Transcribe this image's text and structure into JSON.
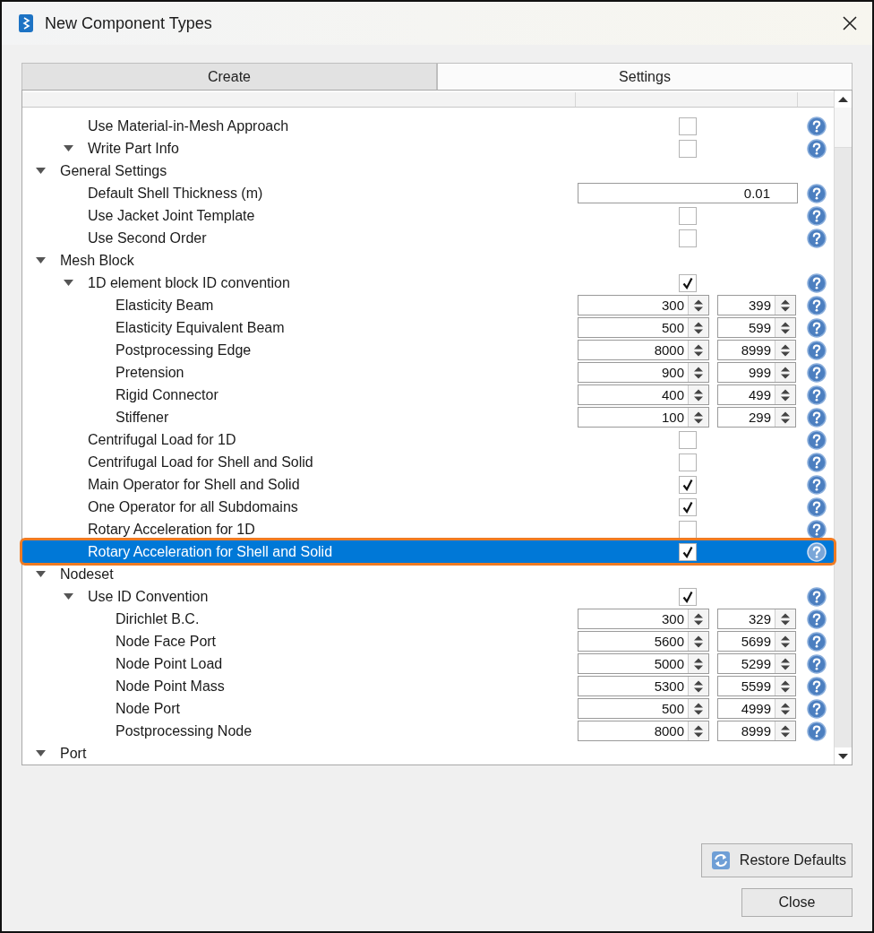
{
  "window": {
    "title": "New Component Types"
  },
  "tabs": [
    {
      "label": "Create",
      "selected": false
    },
    {
      "label": "Settings",
      "selected": true
    }
  ],
  "tree": [
    {
      "children": [
        {
          "label": "Use Material-in-Mesh Approach",
          "selected": false,
          "help": true,
          "control": {
            "kind": "checkbox",
            "checked": false
          }
        },
        {
          "label": "Write Part Info",
          "selected": false,
          "expanded": true,
          "help": true,
          "control": {
            "kind": "checkbox",
            "checked": false
          }
        }
      ]
    },
    {
      "label": "General Settings",
      "selected": false,
      "expanded": true,
      "help": false,
      "children": [
        {
          "label": "Default Shell Thickness (m)",
          "selected": false,
          "help": true,
          "control": {
            "kind": "text",
            "value": "0.01"
          }
        },
        {
          "label": "Use Jacket Joint Template",
          "selected": false,
          "help": true,
          "control": {
            "kind": "checkbox",
            "checked": false
          }
        },
        {
          "label": "Use Second Order",
          "selected": false,
          "help": true,
          "control": {
            "kind": "checkbox",
            "checked": false
          }
        }
      ]
    },
    {
      "label": "Mesh Block",
      "selected": false,
      "expanded": true,
      "help": false,
      "children": [
        {
          "label": "1D element block ID convention",
          "selected": false,
          "expanded": true,
          "help": true,
          "control": {
            "kind": "checkbox",
            "checked": true
          },
          "children": [
            {
              "label": "Elasticity Beam",
              "selected": false,
              "help": true,
              "control": {
                "kind": "range",
                "min": "300",
                "max": "399"
              }
            },
            {
              "label": "Elasticity Equivalent Beam",
              "selected": false,
              "help": true,
              "control": {
                "kind": "range",
                "min": "500",
                "max": "599"
              }
            },
            {
              "label": "Postprocessing Edge",
              "selected": false,
              "help": true,
              "control": {
                "kind": "range",
                "min": "8000",
                "max": "8999"
              }
            },
            {
              "label": "Pretension",
              "selected": false,
              "help": true,
              "control": {
                "kind": "range",
                "min": "900",
                "max": "999"
              }
            },
            {
              "label": "Rigid Connector",
              "selected": false,
              "help": true,
              "control": {
                "kind": "range",
                "min": "400",
                "max": "499"
              }
            },
            {
              "label": "Stiffener",
              "selected": false,
              "help": true,
              "control": {
                "kind": "range",
                "min": "100",
                "max": "299"
              }
            }
          ]
        },
        {
          "label": "Centrifugal Load for 1D",
          "selected": false,
          "help": true,
          "control": {
            "kind": "checkbox",
            "checked": false
          }
        },
        {
          "label": "Centrifugal Load for Shell and Solid",
          "selected": false,
          "help": true,
          "control": {
            "kind": "checkbox",
            "checked": false
          }
        },
        {
          "label": "Main Operator for Shell and Solid",
          "selected": false,
          "help": true,
          "control": {
            "kind": "checkbox",
            "checked": true
          }
        },
        {
          "label": "One Operator for all Subdomains",
          "selected": false,
          "help": true,
          "control": {
            "kind": "checkbox",
            "checked": true
          }
        },
        {
          "label": "Rotary Acceleration for 1D",
          "selected": false,
          "help": true,
          "control": {
            "kind": "checkbox",
            "checked": false
          }
        },
        {
          "label": "Rotary Acceleration for Shell and Solid",
          "selected": true,
          "help": true,
          "control": {
            "kind": "checkbox",
            "checked": true
          }
        }
      ]
    },
    {
      "label": "Nodeset",
      "selected": false,
      "expanded": true,
      "help": false,
      "children": [
        {
          "label": "Use ID Convention",
          "selected": false,
          "expanded": true,
          "help": true,
          "control": {
            "kind": "checkbox",
            "checked": true
          },
          "children": [
            {
              "label": "Dirichlet B.C.",
              "selected": false,
              "help": true,
              "control": {
                "kind": "range",
                "min": "300",
                "max": "329"
              }
            },
            {
              "label": "Node Face Port",
              "selected": false,
              "help": true,
              "control": {
                "kind": "range",
                "min": "5600",
                "max": "5699"
              }
            },
            {
              "label": "Node Point Load",
              "selected": false,
              "help": true,
              "control": {
                "kind": "range",
                "min": "5000",
                "max": "5299"
              }
            },
            {
              "label": "Node Point Mass",
              "selected": false,
              "help": true,
              "control": {
                "kind": "range",
                "min": "5300",
                "max": "5599"
              }
            },
            {
              "label": "Node Port",
              "selected": false,
              "help": true,
              "control": {
                "kind": "range",
                "min": "500",
                "max": "4999"
              }
            },
            {
              "label": "Postprocessing Node",
              "selected": false,
              "help": true,
              "control": {
                "kind": "range",
                "min": "8000",
                "max": "8999"
              }
            }
          ]
        }
      ]
    },
    {
      "label": "Port",
      "selected": false,
      "expanded": true,
      "help": false
    }
  ],
  "buttons": {
    "restore": "Restore Defaults",
    "close": "Close"
  }
}
